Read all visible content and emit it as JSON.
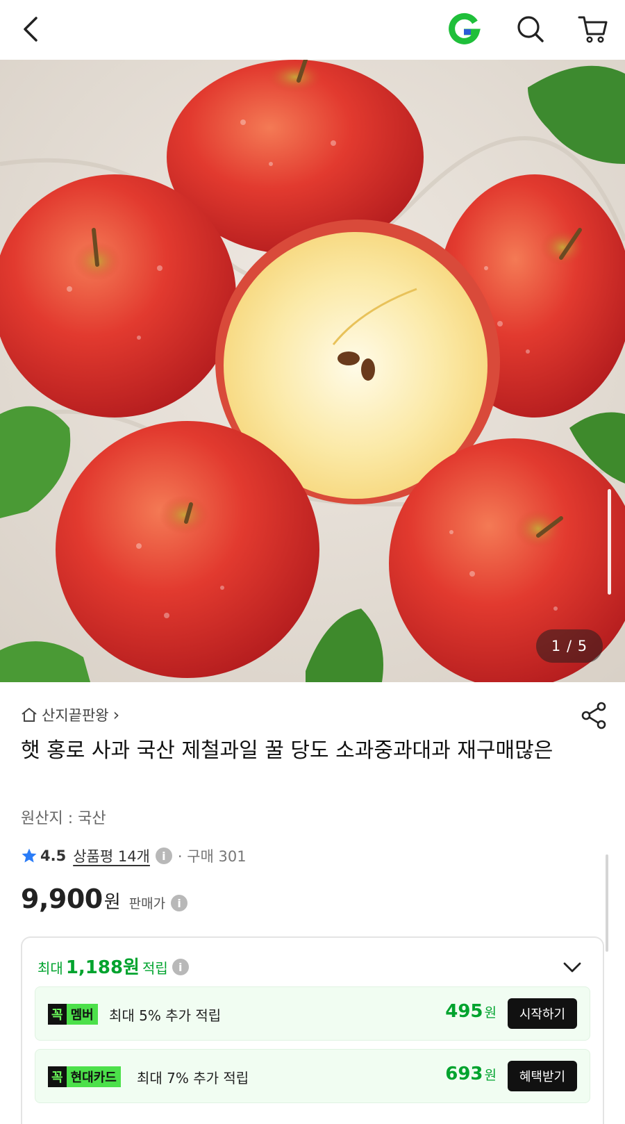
{
  "colors": {
    "brand_green": "#00a32e",
    "badge_green": "#4ce04a",
    "perk_bg": "#f1fdf2",
    "button_dark": "#111111",
    "star_blue": "#2a7cf7"
  },
  "header": {
    "icons": [
      "back-arrow-icon",
      "gmarket-g-logo-icon",
      "search-icon",
      "cart-icon"
    ]
  },
  "gallery": {
    "counter": "1 / 5",
    "image_description_icon": "apple-photo"
  },
  "store": {
    "name": "산지끝판왕",
    "arrow": "›"
  },
  "product": {
    "title": "햇 홍로 사과 국산 제철과일 꿀 당도 소과중과대과 재구매많은",
    "origin": "원산지 : 국산",
    "rating": "4.5",
    "review_label": "상품평 14개",
    "info_glyph": "i",
    "purchase_label": "· 구매 301",
    "price": "9,900",
    "price_unit": "원",
    "price_label": "판매가"
  },
  "rewards": {
    "prefix": "최대",
    "amount": "1,188원",
    "suffix": "적립",
    "perks": [
      {
        "badge_k": "꼭",
        "badge_text": "멤버",
        "desc": "최대 5% 추가 적립",
        "amount": "495",
        "unit": "원",
        "button": "시작하기"
      },
      {
        "badge_k": "꼭",
        "badge_text": "현대카드",
        "desc": "최대 7% 추가 적립",
        "amount": "693",
        "unit": "원",
        "button": "혜택받기"
      }
    ]
  }
}
